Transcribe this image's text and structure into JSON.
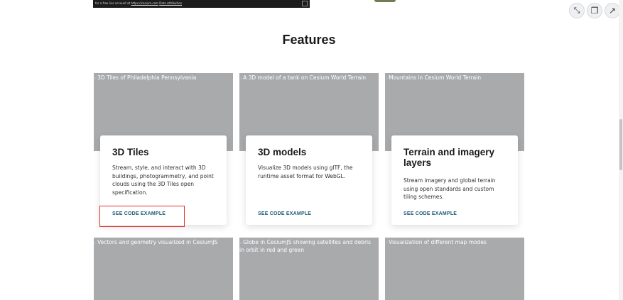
{
  "map_strip": {
    "attribution_prefix": "for a free live account at",
    "attribution_link": "https://cesium.com",
    "attribution_data": "Data attribution"
  },
  "toolbar": {
    "buttons": [
      {
        "icon": "minimize-icon",
        "glyph": "⤡"
      },
      {
        "icon": "copy-icon",
        "glyph": "❐"
      },
      {
        "icon": "open-external-icon",
        "glyph": "↗"
      }
    ]
  },
  "features": {
    "title": "Features",
    "cta_label": "SEE CODE EXAMPLE",
    "row1_images": [
      "3D Tiles of Philadelphia Pennsylvania",
      "A 3D model of a tank on Cesium World Terrain",
      "Mountains in Cesium World Terrain"
    ],
    "cards": [
      {
        "title": "3D Tiles",
        "description": "Stream, style, and interact with 3D buildings, photogrammetry, and point clouds using the 3D Tiles open specification.",
        "cta": "SEE CODE EXAMPLE"
      },
      {
        "title": "3D models",
        "description": "Visualize 3D models using glTF, the runtime asset format for WebGL.",
        "cta": "SEE CODE EXAMPLE"
      },
      {
        "title": "Terrain and imagery layers",
        "description": "Stream imagery and global terrain using open standards and custom tiling schemes.",
        "cta": "SEE CODE EXAMPLE"
      }
    ],
    "row2_images": [
      "Vectors and geometry visualized in CesiumJS",
      "Globe in CesiumJS showing satellites and debris in orbit in red and green",
      "Visualization of different map modes"
    ]
  },
  "colors": {
    "cta": "#1d5b78",
    "placeholder": "#a8aaac",
    "highlight": "#e0342c"
  }
}
